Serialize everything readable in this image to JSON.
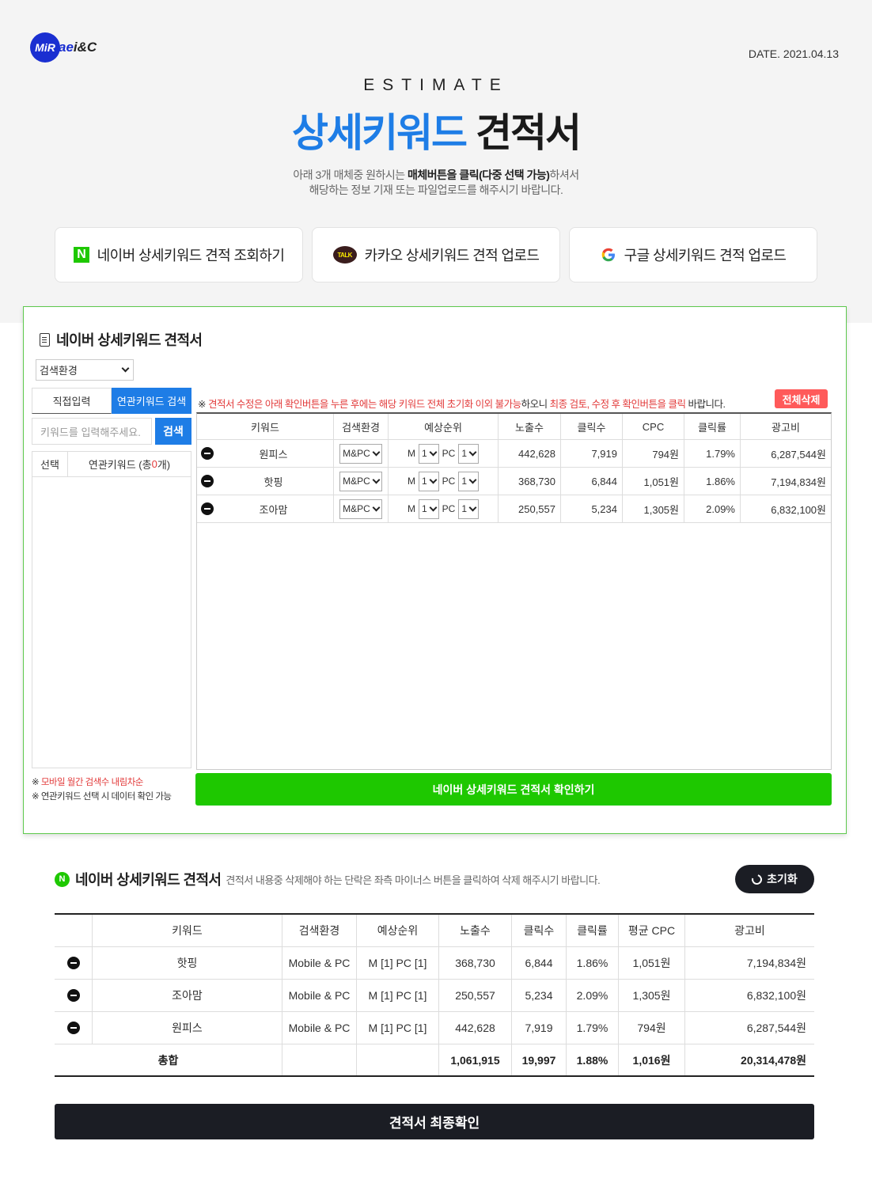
{
  "header": {
    "logo_mark": "MiR",
    "logo_text_a": "ae",
    "logo_text_b": "i&C",
    "date": "DATE. 2021.04.13",
    "subtitle": "ESTIMATE",
    "title_blue": "상세키워드",
    "title_dark": "견적서",
    "intro_line1_a": "아래 3개 매체중 원하시는 ",
    "intro_line1_b": "매체버튼을 클릭(다중 선택 가능)",
    "intro_line1_c": "하셔서",
    "intro_line2": "해당하는 정보 기재 또는 파일업로드를 해주시기 바랍니다."
  },
  "media_buttons": [
    {
      "label": "네이버 상세키워드 견적 조회하기",
      "icon": "naver-icon",
      "icon_text": "N"
    },
    {
      "label": "카카오 상세키워드 견적 업로드",
      "icon": "kakao-talk-icon",
      "icon_text": "TALK"
    },
    {
      "label": "구글 상세키워드 견적 업로드",
      "icon": "google-icon",
      "icon_text": "G"
    }
  ],
  "panel": {
    "title": "네이버 상세키워드 견적서",
    "env_select": "검색환경",
    "tabs": [
      "직접입력",
      "연관키워드 검색"
    ],
    "kw_placeholder": "키워드를 입력해주세요.",
    "search_btn": "검색",
    "rel_cols": [
      "선택",
      "연관키워드 (총 ",
      "0",
      "개)"
    ],
    "note1_prefix": "※ ",
    "note1": "모바일 월간 검색수 내림차순",
    "note2": "※ 연관키워드 선택 시 데이터 확인 가능",
    "warn_prefix": "※ ",
    "warn_red1": "견적서 수정은 아래 확인버튼을 누른 후에는 해당 키워드 전체 초기화 이외 불가능",
    "warn_mid": "하오니 ",
    "warn_red2": "최종 검토, 수정 후 확인버튼을 클릭",
    "warn_end": " 바랍니다.",
    "delete_all": "전체삭제",
    "table_headers": [
      "키워드",
      "검색환경",
      "예상순위",
      "노출수",
      "클릭수",
      "CPC",
      "클릭률",
      "광고비"
    ],
    "rows": [
      {
        "keyword": "원피스",
        "env": "M&PC",
        "m_label": "M",
        "m_rank": "1",
        "pc_label": "PC",
        "pc_rank": "1",
        "impressions": "442,628",
        "clicks": "7,919",
        "cpc": "794원",
        "ctr": "1.79%",
        "cost": "6,287,544원"
      },
      {
        "keyword": "핫핑",
        "env": "M&PC",
        "m_label": "M",
        "m_rank": "1",
        "pc_label": "PC",
        "pc_rank": "1",
        "impressions": "368,730",
        "clicks": "6,844",
        "cpc": "1,051원",
        "ctr": "1.86%",
        "cost": "7,194,834원"
      },
      {
        "keyword": "조아맘",
        "env": "M&PC",
        "m_label": "M",
        "m_rank": "1",
        "pc_label": "PC",
        "pc_rank": "1",
        "impressions": "250,557",
        "clicks": "5,234",
        "cpc": "1,305원",
        "ctr": "2.09%",
        "cost": "6,832,100원"
      }
    ],
    "confirm_btn": "네이버 상세키워드 견적서 확인하기"
  },
  "summary": {
    "icon_text": "N",
    "title": "네이버 상세키워드 견적서",
    "desc": "견적서 내용중 삭제해야 하는 단락은 좌측 마이너스 버튼을 클릭하여 삭제 해주시기 바랍니다.",
    "reset_btn": "초기화",
    "headers": [
      "",
      "키워드",
      "검색환경",
      "예상순위",
      "노출수",
      "클릭수",
      "클릭률",
      "평균 CPC",
      "광고비"
    ],
    "rows": [
      {
        "keyword": "핫핑",
        "env": "Mobile & PC",
        "rank": "M [1]  PC [1]",
        "impressions": "368,730",
        "clicks": "6,844",
        "ctr": "1.86%",
        "cpc": "1,051원",
        "cost": "7,194,834원"
      },
      {
        "keyword": "조아맘",
        "env": "Mobile & PC",
        "rank": "M [1]  PC [1]",
        "impressions": "250,557",
        "clicks": "5,234",
        "ctr": "2.09%",
        "cpc": "1,305원",
        "cost": "6,832,100원"
      },
      {
        "keyword": "원피스",
        "env": "Mobile & PC",
        "rank": "M [1]  PC [1]",
        "impressions": "442,628",
        "clicks": "7,919",
        "ctr": "1.79%",
        "cpc": "794원",
        "cost": "6,287,544원"
      }
    ],
    "total": {
      "label": "총합",
      "impressions": "1,061,915",
      "clicks": "19,997",
      "ctr": "1.88%",
      "cpc": "1,016원",
      "cost": "20,314,478원"
    },
    "final_btn": "견적서 최종확인"
  },
  "colors": {
    "accent_blue": "#1e7de6",
    "naver_green": "#1ec800",
    "warn_red": "#e23a3a",
    "dark": "#1b1d24"
  }
}
